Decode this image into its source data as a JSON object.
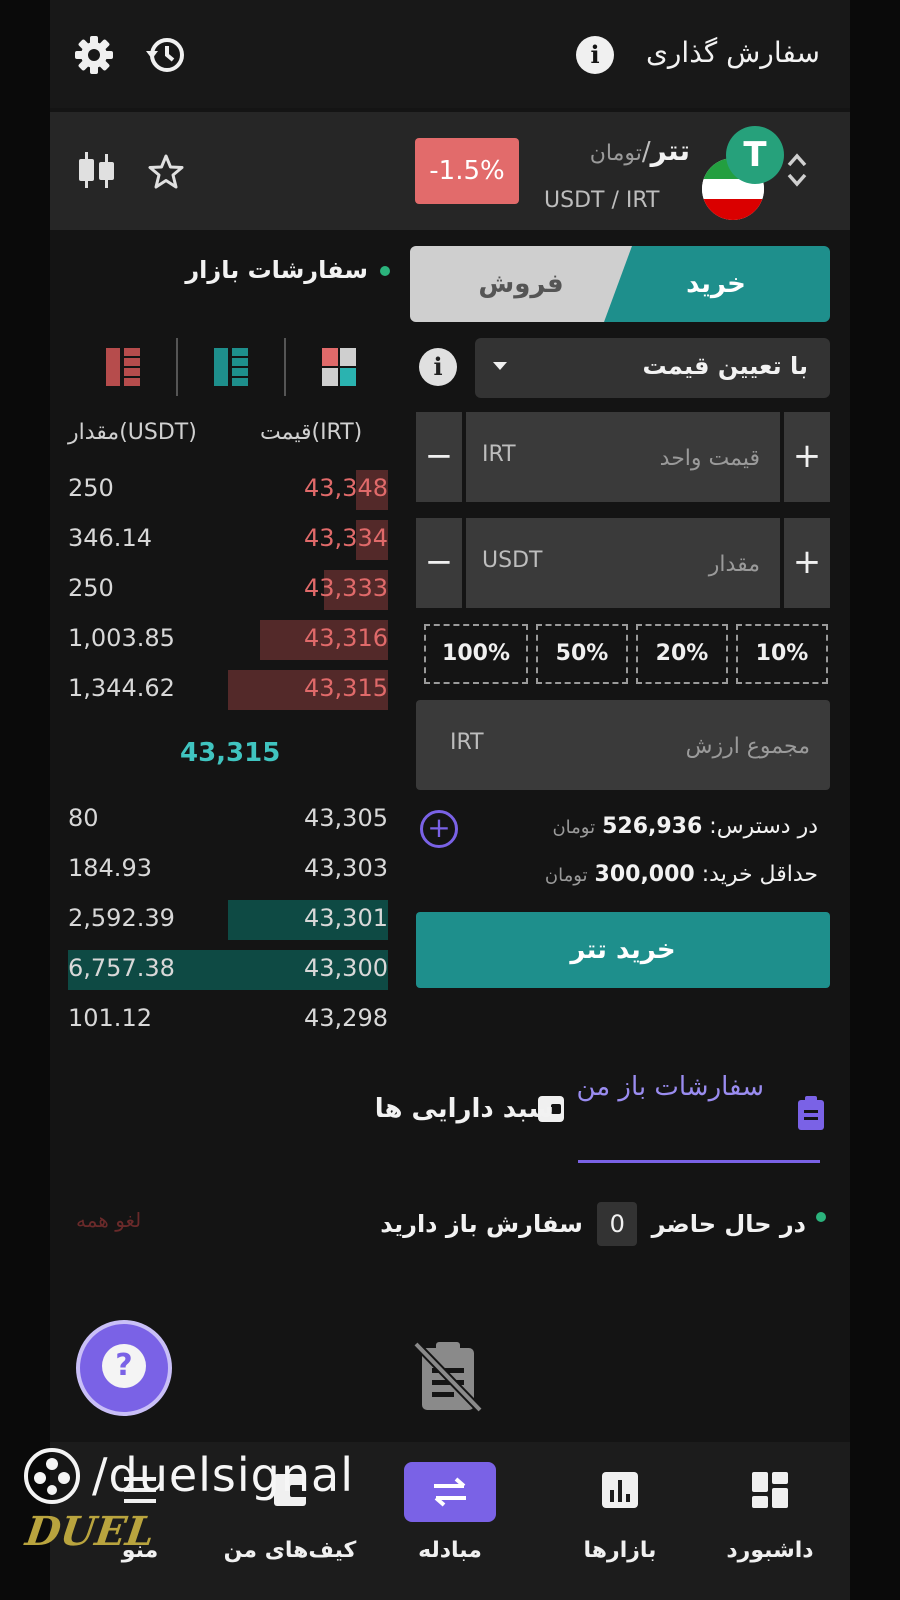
{
  "header": {
    "title": "سفارش گذاری",
    "info_glyph": "i",
    "icons": [
      "info-icon",
      "history-icon",
      "gear-icon"
    ]
  },
  "pair": {
    "name": "تتر",
    "separator": "/",
    "quote_name": "تومان",
    "symbol": "USDT / IRT",
    "change": "-1.5%",
    "icons": [
      "sort-icon",
      "tether-icon",
      "iran-flag-icon",
      "star-icon",
      "candles-icon"
    ]
  },
  "trade": {
    "buy_tab": "خرید",
    "sell_tab": "فروش",
    "order_type": "با تعیین قیمت",
    "price_placeholder": "قیمت واحد",
    "price_unit": "IRT",
    "amount_placeholder": "مقدار",
    "amount_unit": "USDT",
    "percents": [
      "10%",
      "20%",
      "50%",
      "100%"
    ],
    "total_placeholder": "مجموع ارزش",
    "total_unit": "IRT",
    "available_label": "در دسترس:",
    "available_value": "526,936",
    "available_unit": "تومان",
    "min_label": "حداقل خرید:",
    "min_value": "300,000",
    "min_unit": "تومان",
    "submit": "خرید تتر"
  },
  "orderbook": {
    "title": "سفارشات بازار",
    "price_header": "قیمت(IRT)",
    "amount_header": "مقدار(USDT)",
    "asks": [
      {
        "price": "43,348",
        "amount": "250",
        "depth": 0.1
      },
      {
        "price": "43,334",
        "amount": "346.14",
        "depth": 0.1
      },
      {
        "price": "43,333",
        "amount": "250",
        "depth": 0.2
      },
      {
        "price": "43,316",
        "amount": "1,003.85",
        "depth": 0.4
      },
      {
        "price": "43,315",
        "amount": "1,344.62",
        "depth": 0.5
      }
    ],
    "last_price": "43,315",
    "bids": [
      {
        "price": "43,305",
        "amount": "80",
        "depth": 0.0
      },
      {
        "price": "43,303",
        "amount": "184.93",
        "depth": 0.0
      },
      {
        "price": "43,301",
        "amount": "2,592.39",
        "depth": 0.5
      },
      {
        "price": "43,300",
        "amount": "6,757.38",
        "depth": 1.0
      },
      {
        "price": "43,298",
        "amount": "101.12",
        "depth": 0.0
      }
    ]
  },
  "orders": {
    "tab_open": "سفارشات باز من",
    "tab_portfolio": "سبد دارایی ها",
    "status_before": "در حال حاضر",
    "status_count": "0",
    "status_after": "سفارش باز دارید",
    "cancel_all": "لغو همه",
    "help_glyph": "?"
  },
  "nav": {
    "dashboard": "داشبورد",
    "markets": "بازارها",
    "exchange": "مبادله",
    "wallets": "کیف‌های من",
    "menu": "منو"
  },
  "watermark": {
    "handle": "/duelsignal",
    "logo_text": "DUEL"
  },
  "colors": {
    "accent": "#1e8f8c",
    "negative": "#e26b6b",
    "nav_active": "#7a62e6"
  }
}
